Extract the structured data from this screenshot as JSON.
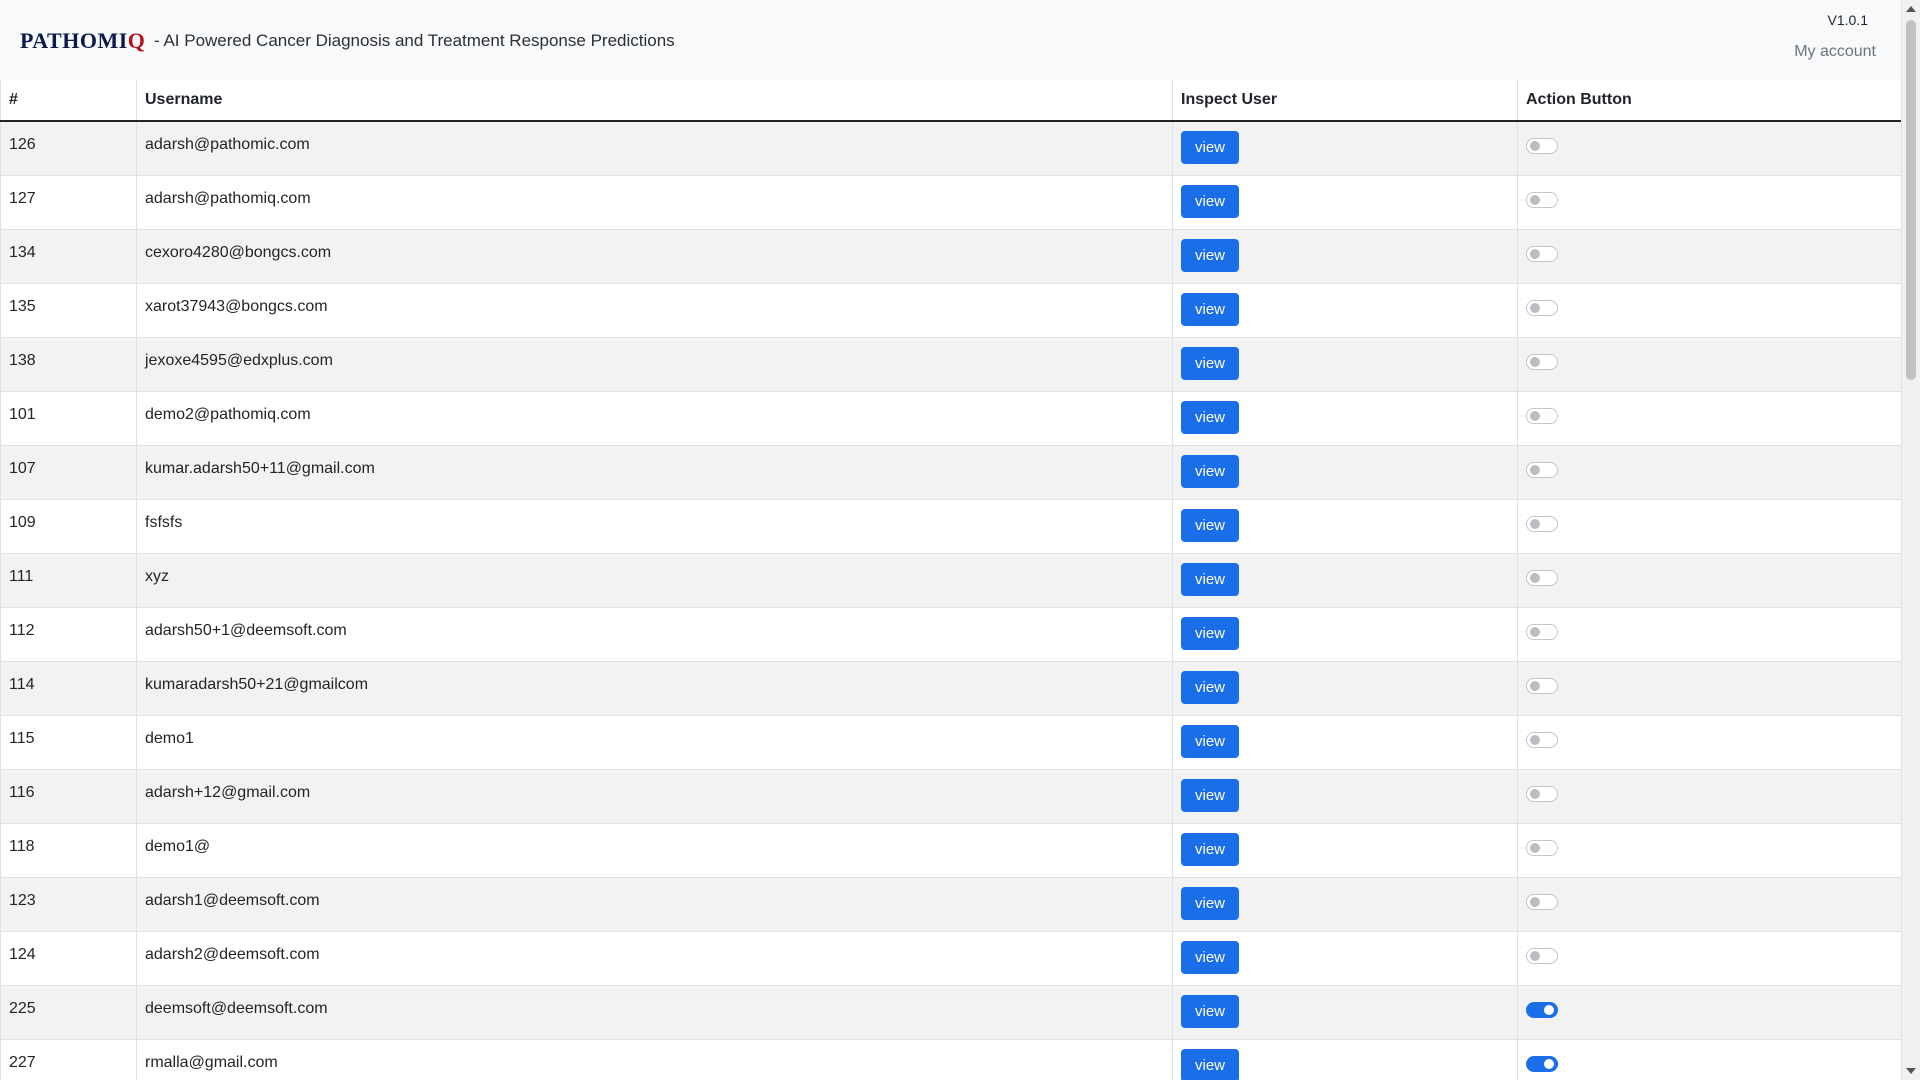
{
  "header": {
    "brand_main": "PATHOMI",
    "brand_accent": "Q",
    "tagline": "- AI Powered Cancer Diagnosis and Treatment Response Predictions",
    "version": "V1.0.1",
    "account_label": "My account"
  },
  "table": {
    "columns": [
      "#",
      "Username",
      "Inspect User",
      "Action Button"
    ],
    "view_label": "view",
    "rows": [
      {
        "id": "126",
        "username": "adarsh@pathomic.com",
        "enabled": false
      },
      {
        "id": "127",
        "username": "adarsh@pathomiq.com",
        "enabled": false
      },
      {
        "id": "134",
        "username": "cexoro4280@bongcs.com",
        "enabled": false
      },
      {
        "id": "135",
        "username": "xarot37943@bongcs.com",
        "enabled": false
      },
      {
        "id": "138",
        "username": "jexoxe4595@edxplus.com",
        "enabled": false
      },
      {
        "id": "101",
        "username": "demo2@pathomiq.com",
        "enabled": false
      },
      {
        "id": "107",
        "username": "kumar.adarsh50+11@gmail.com",
        "enabled": false
      },
      {
        "id": "109",
        "username": "fsfsfs",
        "enabled": false
      },
      {
        "id": "111",
        "username": "xyz",
        "enabled": false
      },
      {
        "id": "112",
        "username": "adarsh50+1@deemsoft.com",
        "enabled": false
      },
      {
        "id": "114",
        "username": "kumaradarsh50+21@gmailcom",
        "enabled": false
      },
      {
        "id": "115",
        "username": "demo1",
        "enabled": false
      },
      {
        "id": "116",
        "username": "adarsh+12@gmail.com",
        "enabled": false
      },
      {
        "id": "118",
        "username": "demo1@",
        "enabled": false
      },
      {
        "id": "123",
        "username": "adarsh1@deemsoft.com",
        "enabled": false
      },
      {
        "id": "124",
        "username": "adarsh2@deemsoft.com",
        "enabled": false
      },
      {
        "id": "225",
        "username": "deemsoft@deemsoft.com",
        "enabled": true
      },
      {
        "id": "227",
        "username": "rmalla@gmail.com",
        "enabled": true
      }
    ]
  },
  "colors": {
    "primary": "#1a6ee8",
    "brand_navy": "#0b1a4a",
    "brand_red": "#b5121b"
  }
}
